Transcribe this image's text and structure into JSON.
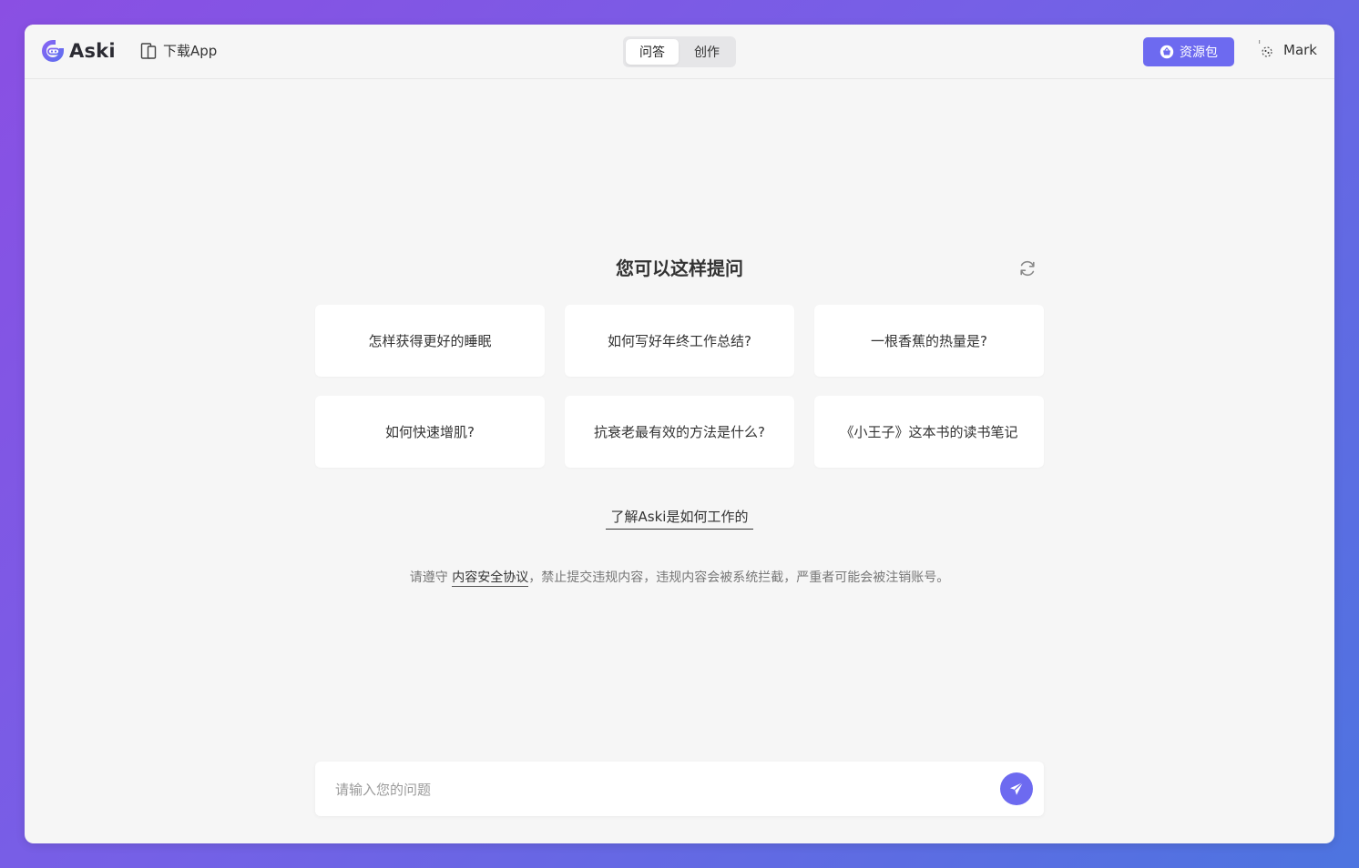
{
  "header": {
    "logo_text": "Aski",
    "download_label": "下载App",
    "tabs": [
      {
        "label": "问答",
        "active": true
      },
      {
        "label": "创作",
        "active": false
      }
    ],
    "resource_button_label": "资源包",
    "user_name": "Mark"
  },
  "main": {
    "title": "您可以这样提问",
    "suggestions": [
      "怎样获得更好的睡眠",
      "如何写好年终工作总结?",
      "一根香蕉的热量是?",
      "如何快速增肌?",
      "抗衰老最有效的方法是什么?",
      "《小王子》这本书的读书笔记"
    ],
    "learn_link": "了解Aski是如何工作的",
    "notice_prefix": "请遵守 ",
    "notice_link": "内容安全协议",
    "notice_suffix": "，禁止提交违规内容，违规内容会被系统拦截，严重者可能会被注销账号。"
  },
  "input": {
    "placeholder": "请输入您的问题",
    "value": ""
  },
  "colors": {
    "accent": "#6d6af0",
    "background": "#f6f6f6"
  },
  "icons": {
    "logo": "aski-logo-icon",
    "download": "phone-tablet-icon",
    "resource": "basket-icon",
    "avatar": "avatar-icon",
    "refresh": "refresh-icon",
    "send": "paper-plane-icon"
  }
}
